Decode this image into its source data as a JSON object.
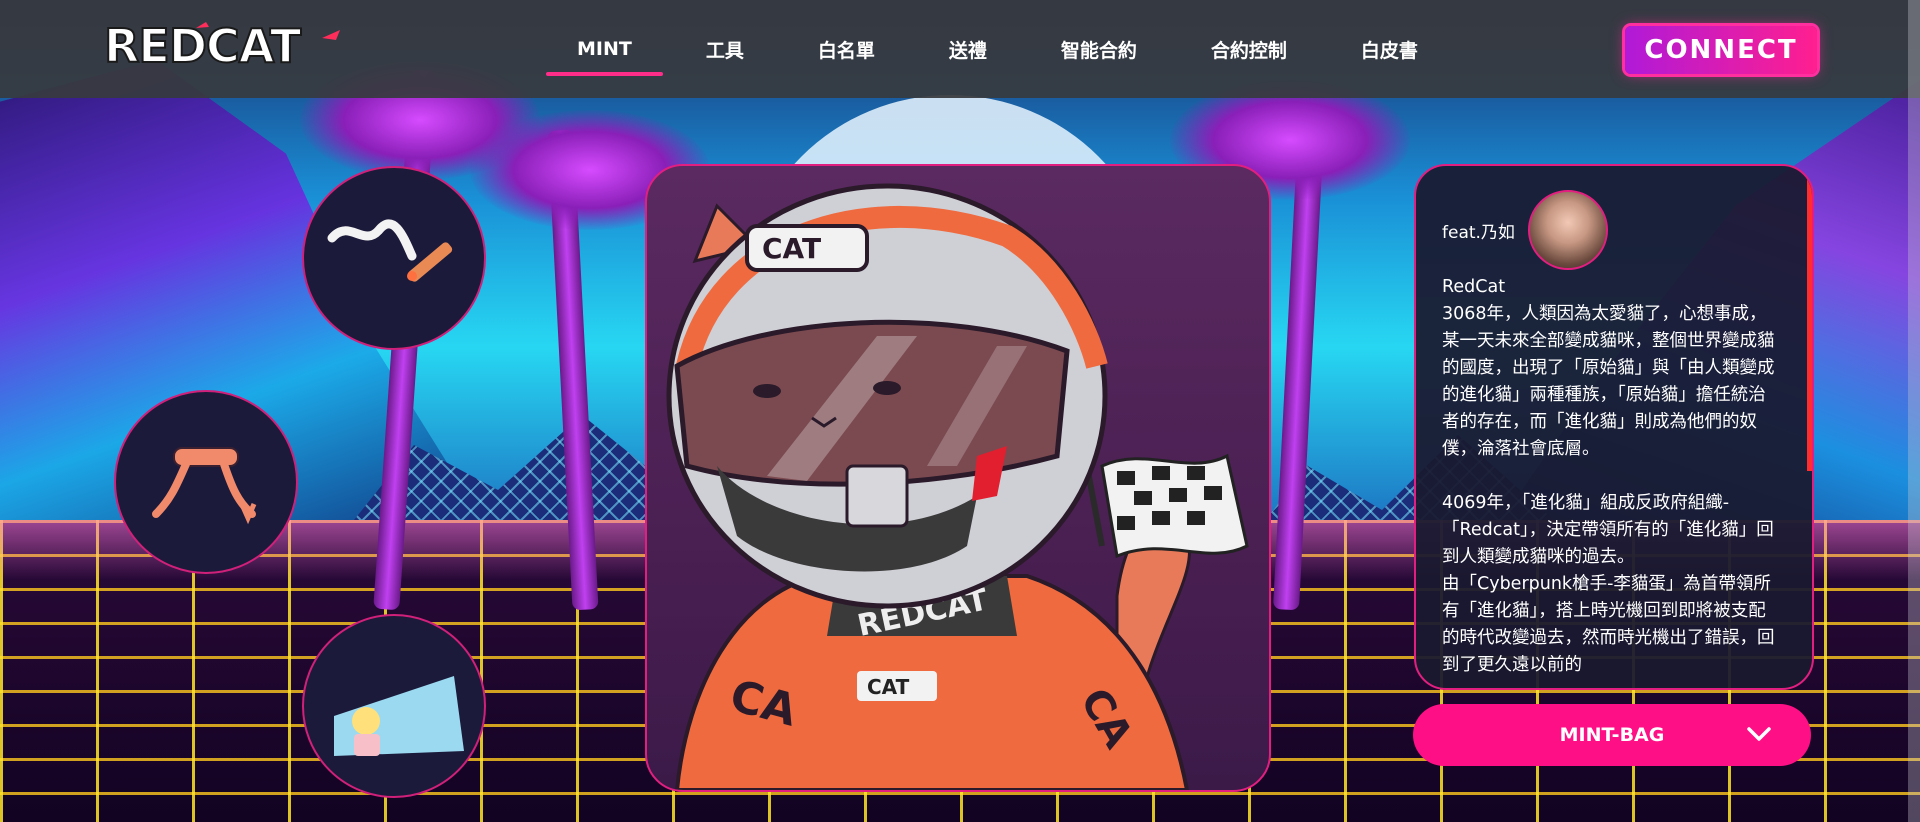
{
  "header": {
    "logo_text": "REDCAT",
    "nav": [
      {
        "label": "MINT",
        "active": true
      },
      {
        "label": "工具",
        "active": false
      },
      {
        "label": "白名單",
        "active": false
      },
      {
        "label": "送禮",
        "active": false
      },
      {
        "label": "智能合約",
        "active": false
      },
      {
        "label": "合約控制",
        "active": false
      },
      {
        "label": "白皮書",
        "active": false
      }
    ],
    "connect_label": "CONNECT"
  },
  "traits": [
    {
      "icon": "cigarette-icon"
    },
    {
      "icon": "hair-tie-icon"
    },
    {
      "icon": "anime-card-icon"
    }
  ],
  "artwork": {
    "helmet_label": "CAT",
    "collar_label": "REDCAT",
    "chest_label": "CAT",
    "arm_label": "CA",
    "side_label": "CA"
  },
  "story": {
    "feat": "feat.乃如",
    "title": "RedCat",
    "paragraphs": [
      "3068年，人類因為太愛貓了，心想事成，某一天未來全部變成貓咪，整個世界變成貓的國度，出現了「原始貓」與「由人類變成的進化貓」兩種種族，「原始貓」擔任統治者的存在，而「進化貓」則成為他們的奴僕，淪落社會底層。",
      "",
      "4069年，「進化貓」組成反政府組織-「Redcat」，決定帶領所有的「進化貓」回到人類變成貓咪的過去。",
      "由「Cyberpunk槍手-李貓蛋」為首帶領所有「進化貓」，搭上時光機回到即將被支配的時代改變過去，然而時光機出了錯誤，回到了更久遠以前的"
    ]
  },
  "mint_bag": {
    "label": "MINT-BAG"
  },
  "colors": {
    "accent": "#ff0f86",
    "header_bg": "#373a3e",
    "border": "#e21f80"
  }
}
